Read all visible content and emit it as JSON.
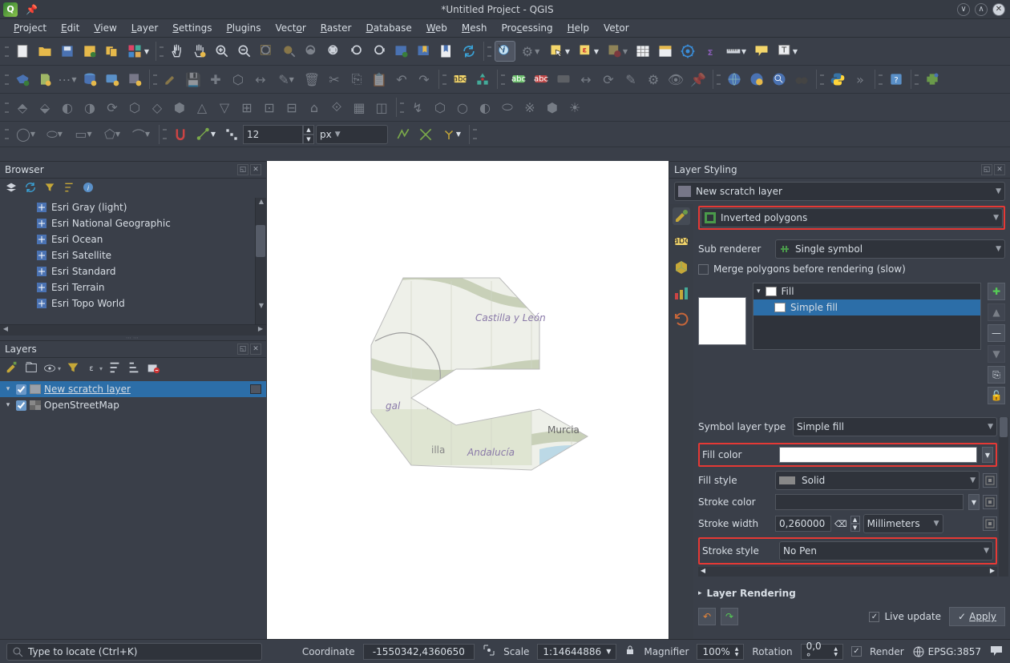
{
  "window": {
    "title": "*Untitled Project - QGIS"
  },
  "menu": [
    "Project",
    "Edit",
    "View",
    "Layer",
    "Settings",
    "Plugins",
    "Vector",
    "Raster",
    "Database",
    "Web",
    "Mesh",
    "Processing",
    "Help",
    "Vetor"
  ],
  "toolbar4": {
    "size_value": "12",
    "size_unit": "px"
  },
  "browser": {
    "title": "Browser",
    "items": [
      "Esri Gray (light)",
      "Esri National Geographic",
      "Esri Ocean",
      "Esri Satellite",
      "Esri Standard",
      "Esri Terrain",
      "Esri Topo World"
    ]
  },
  "layers": {
    "title": "Layers",
    "items": [
      {
        "name": "New scratch layer",
        "selected": true,
        "checked": true,
        "swatch": "#9aa0a9"
      },
      {
        "name": "OpenStreetMap",
        "selected": false,
        "checked": true,
        "swatch": null
      }
    ]
  },
  "map_labels": {
    "castilla": "Castilla y León",
    "portugal": "gal",
    "andalucia": "Andalucía",
    "murcia": "Murcia",
    "illa": "illa"
  },
  "styling": {
    "title": "Layer Styling",
    "layer": "New scratch layer",
    "renderer": "Inverted polygons",
    "sub_renderer_label": "Sub renderer",
    "sub_renderer_value": "Single symbol",
    "merge_label": "Merge polygons before rendering (slow)",
    "fill_node": "Fill",
    "simple_fill_node": "Simple fill",
    "symbol_layer_type_label": "Symbol layer type",
    "symbol_layer_type_value": "Simple fill",
    "fill_color_label": "Fill color",
    "fill_style_label": "Fill style",
    "fill_style_value": "Solid",
    "stroke_color_label": "Stroke color",
    "stroke_width_label": "Stroke width",
    "stroke_width_value": "0,260000",
    "stroke_width_unit": "Millimeters",
    "stroke_style_label": "Stroke style",
    "stroke_style_value": "No Pen",
    "layer_rendering": "Layer Rendering",
    "live_update": "Live update",
    "apply": "Apply"
  },
  "status": {
    "locator_placeholder": "Type to locate (Ctrl+K)",
    "coordinate_label": "Coordinate",
    "coordinate_value": "-1550342,4360650",
    "scale_label": "Scale",
    "scale_value": "1:14644886",
    "magnifier_label": "Magnifier",
    "magnifier_value": "100%",
    "rotation_label": "Rotation",
    "rotation_value": "0,0 °",
    "render_label": "Render",
    "crs": "EPSG:3857"
  }
}
